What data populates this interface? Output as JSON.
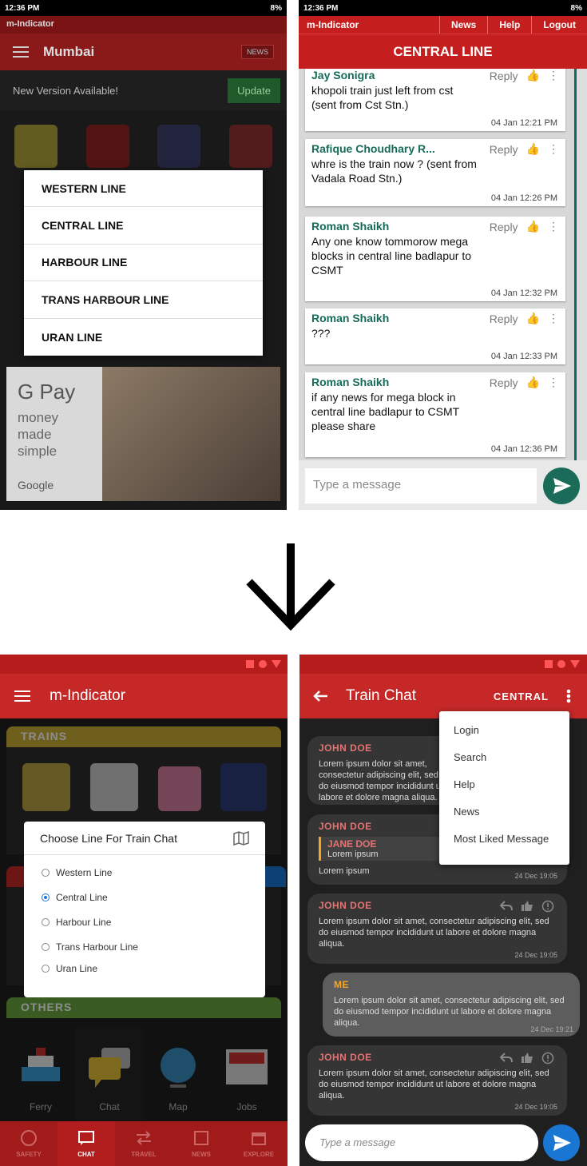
{
  "old_home": {
    "status_time": "12:36 PM",
    "battery": "8%",
    "app_name": "m-Indicator",
    "city": "Mumbai",
    "news_button": "NEWS",
    "update_text": "New Version Available!",
    "update_button": "Update",
    "lines": [
      "WESTERN LINE",
      "CENTRAL LINE",
      "HARBOUR LINE",
      "TRANS HARBOUR LINE",
      "URAN LINE"
    ],
    "ad": {
      "brand": "G Pay",
      "tagline_1": "money made",
      "tagline_2": "simple",
      "google": "Google"
    }
  },
  "old_chat": {
    "status_time": "12:36 PM",
    "battery": "8%",
    "app_name": "m-Indicator",
    "nav": [
      "News",
      "Help",
      "Logout"
    ],
    "title": "CENTRAL LINE",
    "reply_label": "Reply",
    "messages": [
      {
        "name": "Jay Sonigra",
        "text": "khopoli train just left from cst (sent from Cst Stn.)",
        "time": "04 Jan 12:21 PM"
      },
      {
        "name": "Rafique Choudhary R...",
        "text": "whre is the train now ? (sent from Vadala Road Stn.)",
        "time": "04 Jan 12:26 PM"
      },
      {
        "name": "Roman Shaikh",
        "text": "Any one know tommorow mega blocks in central line badlapur to CSMT",
        "time": "04 Jan 12:32 PM"
      },
      {
        "name": "Roman Shaikh",
        "text": "???",
        "time": "04 Jan 12:33 PM"
      },
      {
        "name": "Roman Shaikh",
        "text": "if any news for mega block in central line badlapur to CSMT please share",
        "time": "04 Jan 12:36 PM"
      }
    ],
    "input_placeholder": "Type a message"
  },
  "new_home": {
    "title": "m-Indicator",
    "trains_header": "TRAINS",
    "others_header": "OTHERS",
    "dialog_title": "Choose Line For Train Chat",
    "options": [
      "Western Line",
      "Central Line",
      "Harbour Line",
      "Trans Harbour Line",
      "Uran Line"
    ],
    "selected_option": "Central Line",
    "others": [
      "Ferry",
      "Chat",
      "Map",
      "Jobs"
    ],
    "bottom_nav": [
      "SAFETY",
      "CHAT",
      "TRAVEL",
      "NEWS",
      "EXPLORE"
    ],
    "active_nav": "CHAT"
  },
  "new_chat": {
    "title": "Train Chat",
    "line": "CENTRAL",
    "menu": [
      "Login",
      "Search",
      "Help",
      "News",
      "Most Liked Message"
    ],
    "messages": [
      {
        "name": "JOHN DOE",
        "text": "Lorem ipsum dolor sit amet, consectetur adipiscing elit, sed do eiusmod tempor incididunt ut labore et dolore magna aliqua.",
        "time": ""
      },
      {
        "name": "JOHN DOE",
        "quote_name": "JANE DOE",
        "quote_text": "Lorem ipsum",
        "text": "Lorem ipsum",
        "time": "24 Dec 19:05"
      },
      {
        "name": "JOHN DOE",
        "text": "Lorem ipsum dolor sit amet, consectetur adipiscing elit, sed do eiusmod tempor incididunt ut labore et dolore magna aliqua.",
        "time": "24 Dec 19:05"
      },
      {
        "name": "ME",
        "text": "Lorem ipsum dolor sit amet, consectetur adipiscing elit, sed do eiusmod tempor incididunt ut labore et dolore magna aliqua.",
        "time": "24 Dec 19:21"
      },
      {
        "name": "JOHN DOE",
        "text": "Lorem ipsum dolor sit amet, consectetur adipiscing elit, sed do eiusmod tempor incididunt ut labore et dolore magna aliqua.",
        "time": "24 Dec 19:05"
      }
    ],
    "input_placeholder": "Type a message"
  },
  "colors": {
    "old_red": "#c41e1e",
    "old_teal": "#166b58",
    "new_red": "#c62828",
    "accent_blue": "#1976d2",
    "me_orange": "#f5a623",
    "name_red": "#e57373"
  }
}
